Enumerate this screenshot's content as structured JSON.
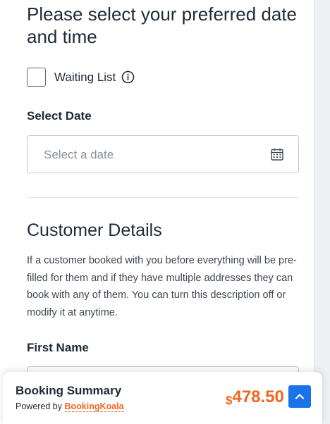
{
  "form": {
    "heading": "Please select your preferred date and time",
    "waiting_list_label": "Waiting List",
    "waiting_list_checked": false,
    "select_date_label": "Select Date",
    "select_date_placeholder": "Select a date"
  },
  "customer": {
    "heading": "Customer Details",
    "description": "If a customer booked with you before everything will be pre-filled for them and if they have multiple addresses they can book with any of them. You can turn this description off or modify it at anytime.",
    "first_name_label": "First Name",
    "first_name_value": ""
  },
  "summary": {
    "title": "Booking Summary",
    "powered_by": "Powered by",
    "brand": "BookingKoala",
    "currency": "$",
    "amount": "478.50"
  },
  "icons": {
    "info": "info-circle-icon",
    "calendar": "calendar-icon",
    "scroll_top": "chevron-up-icon"
  },
  "colors": {
    "accent": "#f26522",
    "button": "#1a73e8",
    "text": "#1f2a37"
  }
}
